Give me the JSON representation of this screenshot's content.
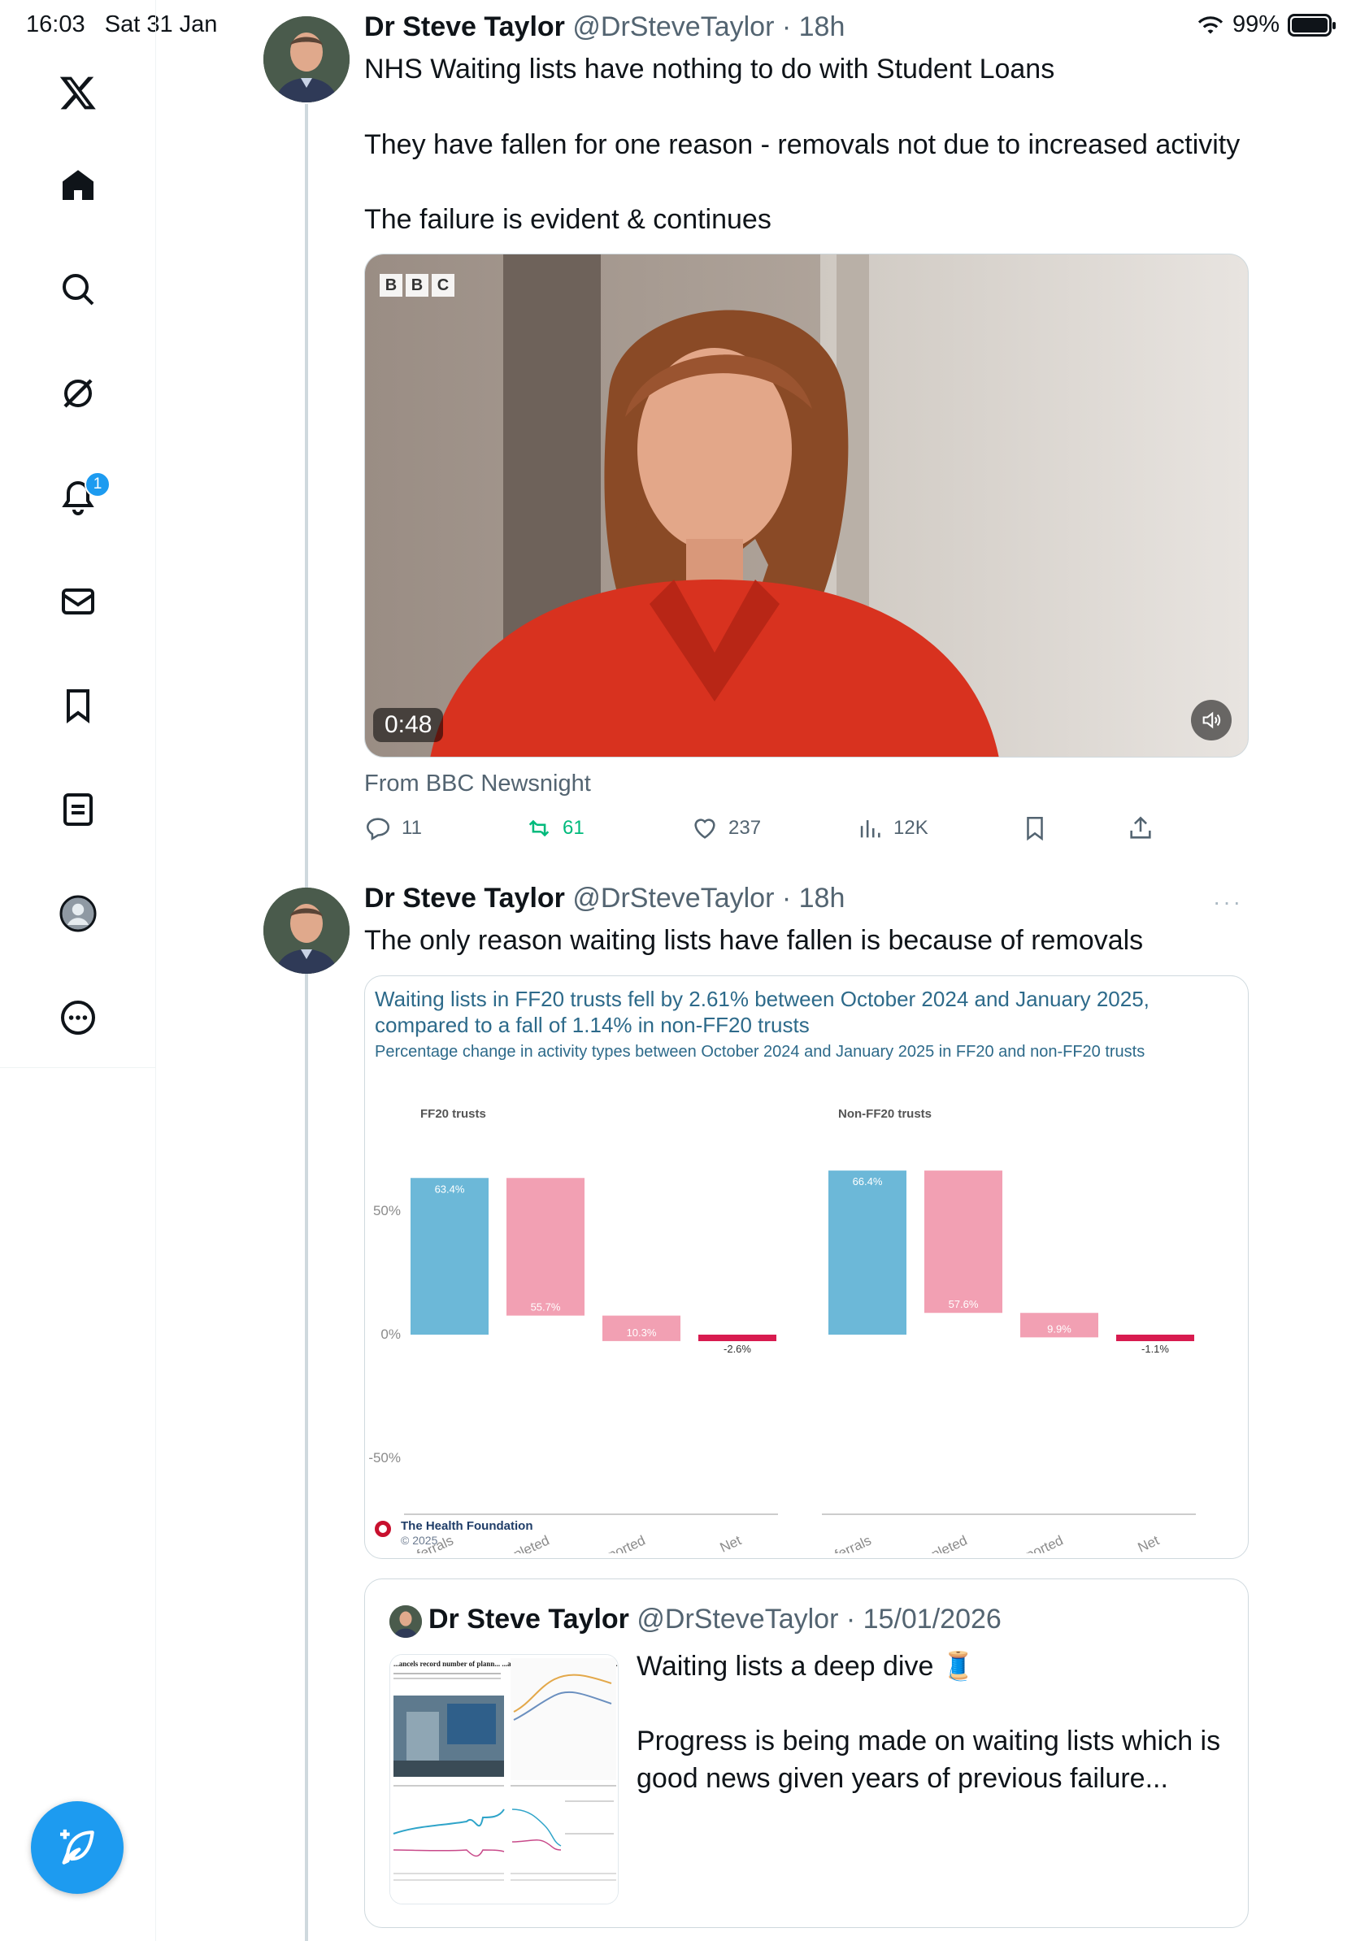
{
  "status_bar": {
    "time": "16:03",
    "date": "Sat 31 Jan",
    "battery": "99%"
  },
  "sidebar": {
    "items": [
      "x-logo",
      "home",
      "search",
      "grok",
      "notifications",
      "messages",
      "bookmarks",
      "lists",
      "profile",
      "more"
    ],
    "notification_count": "1"
  },
  "tweets": [
    {
      "name": "Dr Steve Taylor",
      "handle": "@DrSteveTaylor",
      "time": "· 18h",
      "lines": [
        "NHS Waiting lists have nothing to do with Student Loans",
        "They have fallen for one reason - removals not due to increased activity",
        "The failure is evident & continues"
      ],
      "video": {
        "duration": "0:48",
        "source": "From BBC Newsnight",
        "logo": [
          "B",
          "B",
          "C"
        ]
      },
      "actions": {
        "replies": "11",
        "reposts": "61",
        "likes": "237",
        "views": "12K"
      }
    },
    {
      "name": "Dr Steve Taylor",
      "handle": "@DrSteveTaylor",
      "time": "· 18h",
      "text": "The only reason waiting lists have fallen is because of removals",
      "more": "···"
    }
  ],
  "chart": {
    "title": "Waiting lists in FF20 trusts fell by 2.61% between October 2024 and January 2025, compared to a fall of 1.14% in non-FF20 trusts",
    "subtitle": "Percentage change in activity types between October 2024 and January 2025 in FF20 and non-FF20 trusts",
    "source": "The Health Foundation",
    "source_year": "© 2025"
  },
  "chart_data": {
    "type": "bar",
    "categories": [
      "Referrals",
      "Completed pathways",
      "Unreported removals",
      "Net change"
    ],
    "panels": [
      {
        "name": "FF20 trusts",
        "values": [
          63.4,
          -55.7,
          -10.3,
          -2.6
        ],
        "labels": [
          "63.4%",
          "55.7%",
          "10.3%",
          "-2.6%"
        ]
      },
      {
        "name": "Non-FF20 trusts",
        "values": [
          66.4,
          -57.6,
          -9.9,
          -1.1
        ],
        "labels": [
          "66.4%",
          "57.6%",
          "9.9%",
          "-1.1%"
        ]
      }
    ],
    "y_ticks": [
      "50%",
      "0%",
      "-50%"
    ],
    "y_tick_values": [
      50,
      0,
      -50
    ],
    "ylim": [
      -60,
      70
    ],
    "colors": {
      "positive": "#6cb8d8",
      "negative": "#f2a0b3",
      "net": "#d81b4f"
    }
  },
  "quote": {
    "name": "Dr Steve Taylor",
    "handle": "@DrSteveTaylor",
    "date": "· 15/01/2026",
    "title": "Waiting lists a deep dive 🧵",
    "text": "Progress is being made on waiting lists which is good news given years of previous failure...",
    "thumb_headline": "...ancels record number of plann... ...ations at the last minute, data sho..."
  },
  "colors": {
    "accent": "#1d9bf0",
    "retweet": "#00ba7c",
    "text": "#0f1419",
    "muted": "#536471"
  }
}
